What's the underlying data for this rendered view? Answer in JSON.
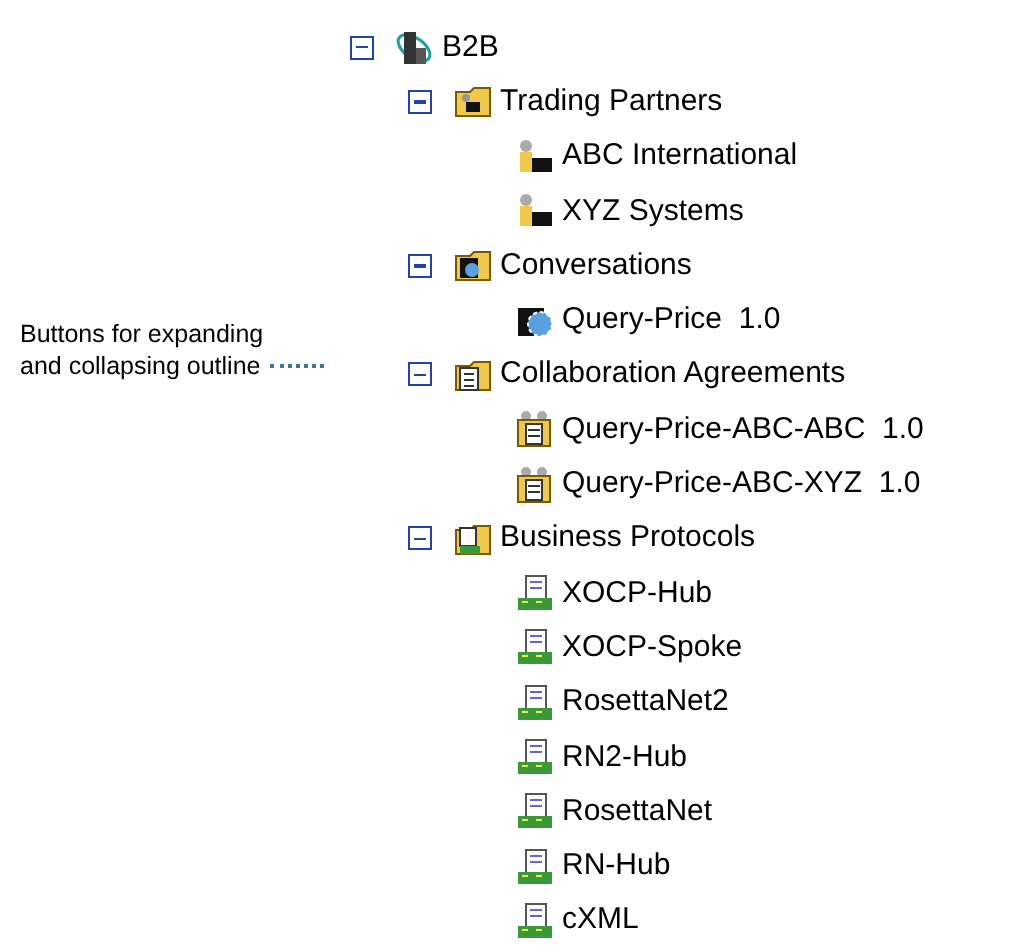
{
  "callout": {
    "lines": [
      "Buttons for expanding",
      "and collapsing outline"
    ]
  },
  "tree": [
    {
      "label": "B2B",
      "kind": "server",
      "expanded": true,
      "children": [
        {
          "label": "Trading Partners",
          "kind": "partners-folder",
          "expanded": true,
          "children": [
            {
              "label": "ABC International",
              "kind": "partner"
            },
            {
              "label": "XYZ Systems",
              "kind": "partner"
            }
          ]
        },
        {
          "label": "Conversations",
          "kind": "conversations-folder",
          "expanded": true,
          "children": [
            {
              "label": "Query-Price  1.0",
              "kind": "conversation"
            }
          ]
        },
        {
          "label": "Collaboration Agreements",
          "kind": "agreements-folder",
          "expanded": true,
          "children": [
            {
              "label": "Query-Price-ABC-ABC  1.0",
              "kind": "agreement"
            },
            {
              "label": "Query-Price-ABC-XYZ  1.0",
              "kind": "agreement"
            }
          ]
        },
        {
          "label": "Business Protocols",
          "kind": "protocols-folder",
          "expanded": true,
          "children": [
            {
              "label": "XOCP-Hub",
              "kind": "protocol"
            },
            {
              "label": "XOCP-Spoke",
              "kind": "protocol"
            },
            {
              "label": "RosettaNet2",
              "kind": "protocol"
            },
            {
              "label": "RN2-Hub",
              "kind": "protocol"
            },
            {
              "label": "RosettaNet",
              "kind": "protocol"
            },
            {
              "label": "RN-Hub",
              "kind": "protocol"
            },
            {
              "label": "cXML",
              "kind": "protocol"
            }
          ]
        }
      ]
    }
  ]
}
